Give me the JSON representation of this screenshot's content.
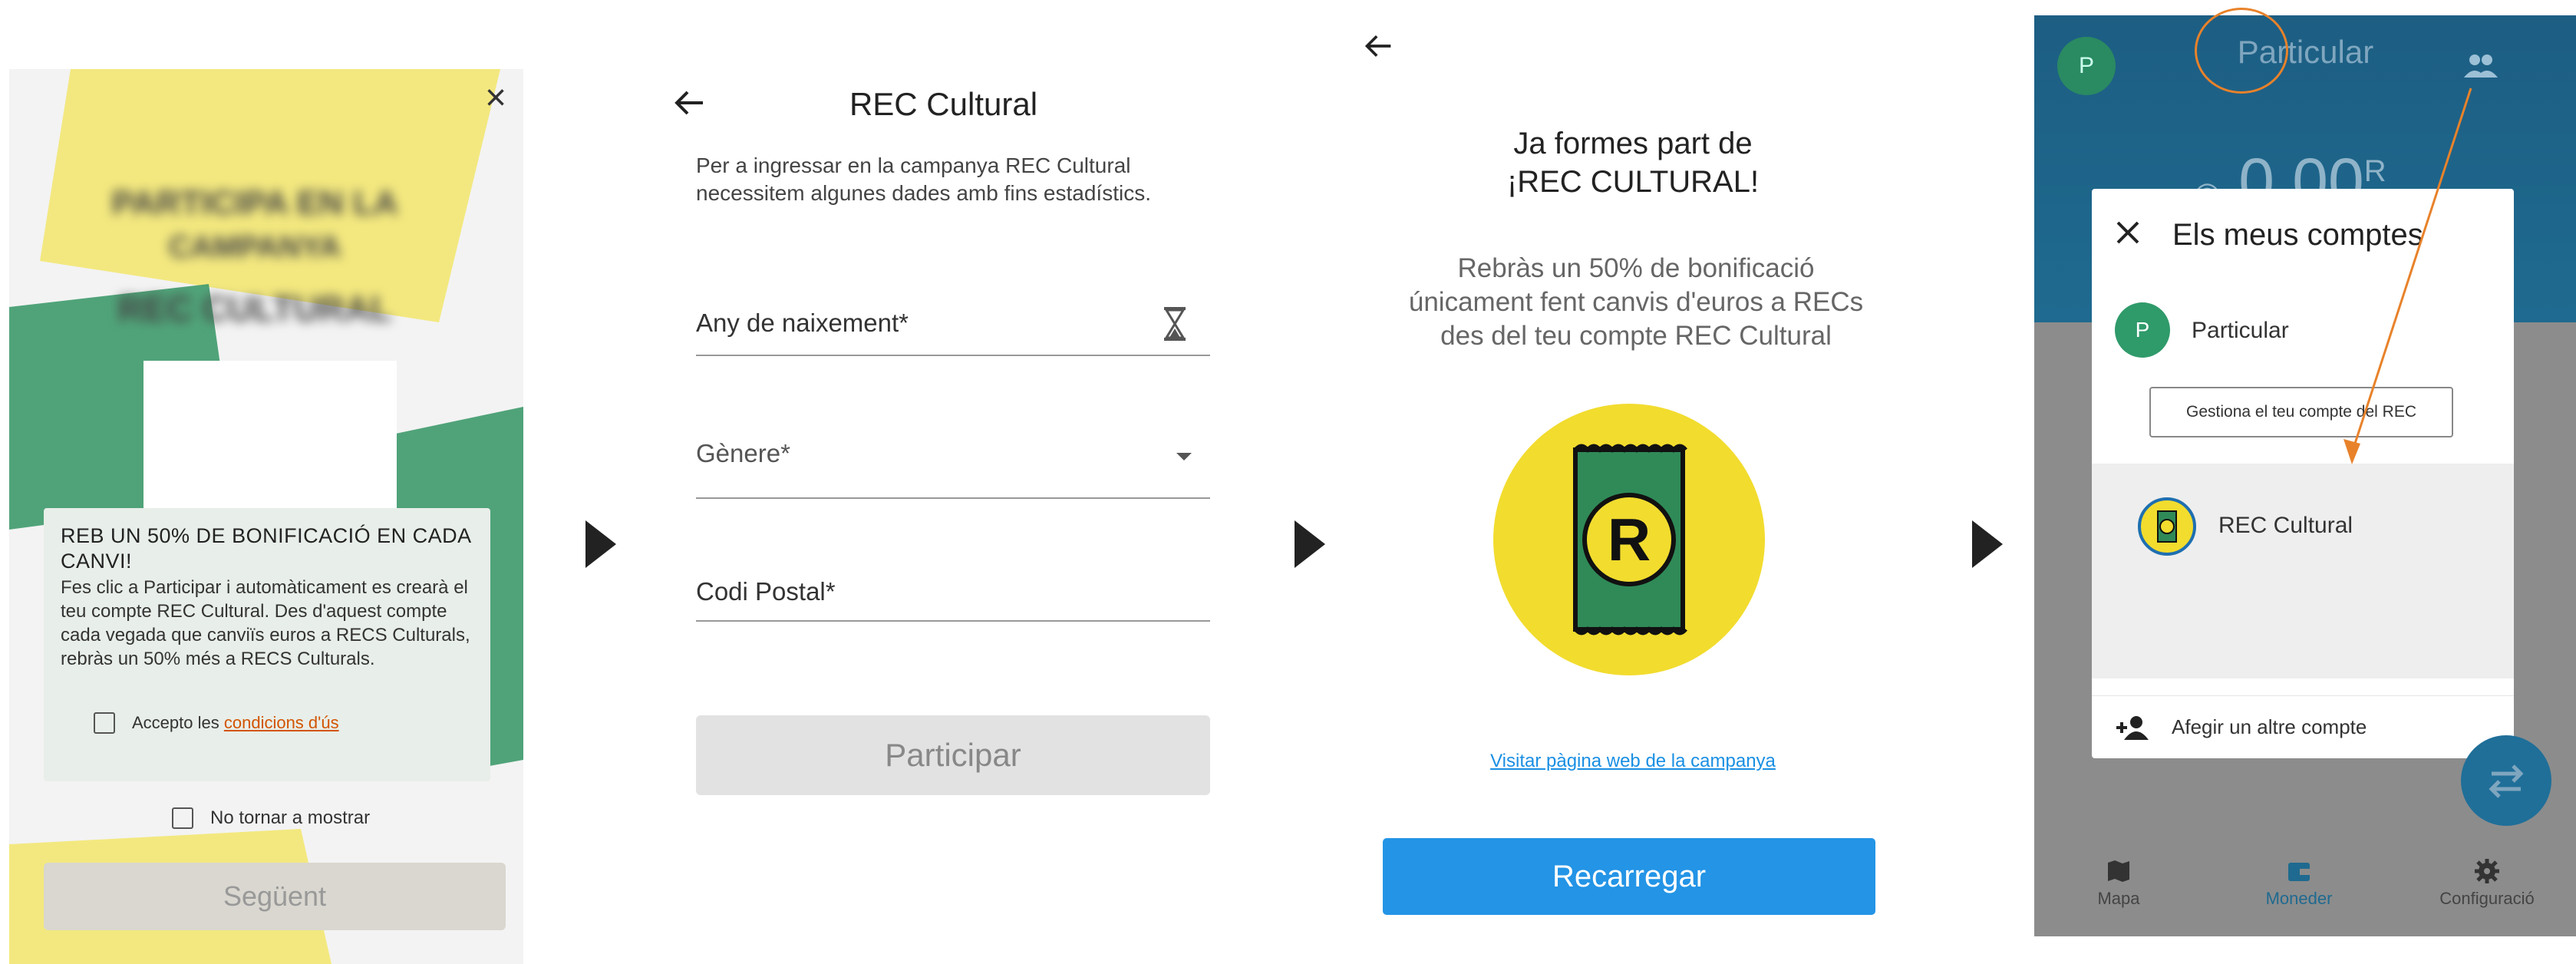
{
  "screen1": {
    "blurred_title_lines": [
      "PARTICIPA EN LA",
      "CAMPANYA",
      "REC CULTURAL"
    ],
    "card_title": "REB UN 50% DE BONIFICACIÓ EN CADA CANVI!",
    "card_body": "Fes clic a Participar i automàticament es crearà el teu compte REC Cultural. Des d'aquest compte cada vegada que canviïs euros a RECS Culturals, rebràs un 50% més a RECS Culturals.",
    "terms_prefix": "Accepto les",
    "terms_link": "condicions d'ús",
    "dont_show_label": "No tornar a mostrar",
    "next_button": "Següent",
    "close_glyph": "×"
  },
  "screen2": {
    "title": "REC Cultural",
    "intro": "Per a ingressar en la campanya REC Cultural necessitem algunes dades amb fins estadístics.",
    "field_birth_year": "Any de naixement*",
    "field_gender": "Gènere*",
    "field_postal_code": "Codi Postal*",
    "participate_button": "Participar"
  },
  "screen3": {
    "title_line1": "Ja formes part de",
    "title_line2": "¡REC CULTURAL!",
    "description": "Rebràs un 50% de bonificació únicament fent canvis d'euros a RECs des del teu compte REC Cultural",
    "logo_letter": "R",
    "campaign_link": "Visitar pàgina web de la campanya",
    "recharge_button": "Recarregar"
  },
  "screen4": {
    "top_avatar_letter": "P",
    "top_title": "Particular",
    "balance": "0,00",
    "balance_currency": "R",
    "modal_title": "Els meus comptes",
    "account_avatar_letter": "P",
    "account_name": "Particular",
    "manage_button": "Gestiona el teu compte del REC",
    "rec_account_name": "REC Cultural",
    "add_account_label": "Afegir un altre compte",
    "tabs": [
      {
        "label": "Mapa",
        "icon": "map-icon"
      },
      {
        "label": "Moneder",
        "icon": "wallet-icon"
      },
      {
        "label": "Configuració",
        "icon": "gear-icon"
      }
    ],
    "highlight_color": "#e8822a"
  },
  "colors": {
    "primary_blue": "#2394e6",
    "rec_yellow": "#f2dc2e",
    "rec_green": "#2f8a57",
    "link_orange": "#d35400"
  }
}
